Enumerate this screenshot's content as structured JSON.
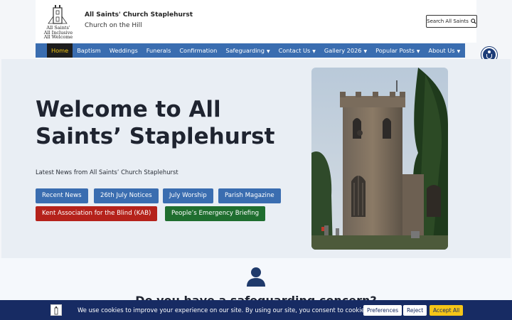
{
  "header": {
    "site_title": "All Saints' Church Staplehurst",
    "tagline": "Church on the Hill",
    "logo_text": [
      "All Saints'",
      "All Inclusive",
      "All Welcome"
    ],
    "search_label": "Search All Saints",
    "search_icon": "search-icon"
  },
  "nav": {
    "items": [
      {
        "label": "Home",
        "active": true
      },
      {
        "label": "Baptism"
      },
      {
        "label": "Weddings"
      },
      {
        "label": "Funerals"
      },
      {
        "label": "Confirmation"
      },
      {
        "label": "Safeguarding",
        "dropdown": true
      },
      {
        "label": "Contact Us",
        "dropdown": true
      },
      {
        "label": "Gallery 2026",
        "dropdown": true
      },
      {
        "label": "Popular Posts",
        "dropdown": true
      },
      {
        "label": "About Us",
        "dropdown": true
      }
    ]
  },
  "accessibility": {
    "icon": "accessibility-icon"
  },
  "hero": {
    "title": "Welcome to All Saints’ Staplehurst",
    "subtitle": "Latest News from All Saints’ Church Staplehurst",
    "buttons": [
      {
        "label": "Recent News",
        "color": "#3a6db0"
      },
      {
        "label": "26th July Notices",
        "color": "#3a6db0"
      },
      {
        "label": "July Worship",
        "color": "#3a6db0"
      },
      {
        "label": "Parish Magazine",
        "color": "#3a6db0"
      },
      {
        "label": "Kent Association for the Blind (KAB)",
        "color": "#b5221b"
      },
      {
        "label": "People’s Emergency Briefing",
        "color": "#1f6e2f"
      }
    ]
  },
  "safeguarding": {
    "heading": "Do you have a safeguarding concern?",
    "icon": "person-icon"
  },
  "cookie_banner": {
    "message": "We use cookies to improve your experience on our site. By using our site, you consent to cookies.",
    "preferences_label": "Preferences",
    "reject_label": "Reject",
    "accept_label": "Accept All"
  },
  "colors": {
    "nav_bg": "#3a6db0",
    "active_text": "#f1c40f",
    "cookie_bg": "#172b63",
    "accept_bg": "#f5c518"
  }
}
